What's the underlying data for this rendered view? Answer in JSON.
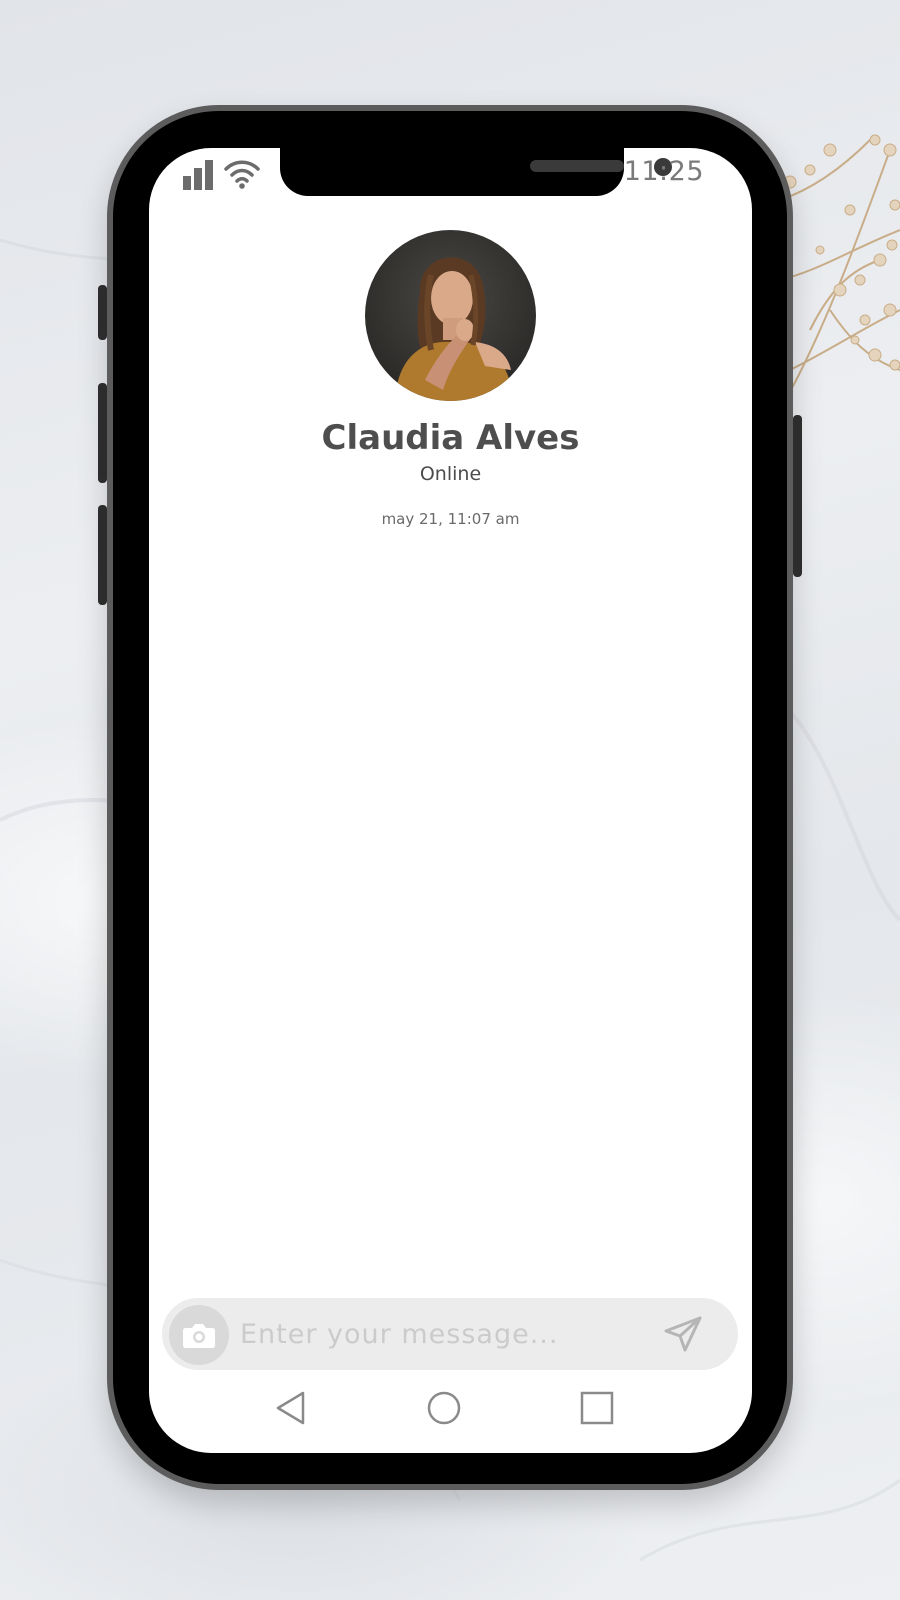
{
  "status_bar": {
    "time": "11:25",
    "signal_icon": "signal-bars-icon",
    "wifi_icon": "wifi-icon"
  },
  "contact": {
    "name": "Claudia Alves",
    "status": "Online",
    "avatar_icon": "avatar-photo"
  },
  "conversation": {
    "timestamp": "may 21, 11:07 am"
  },
  "composer": {
    "placeholder": "Enter your message...",
    "camera_icon": "camera-icon",
    "send_icon": "send-icon"
  },
  "nav_bar": {
    "back_icon": "triangle-back-icon",
    "home_icon": "circle-home-icon",
    "recents_icon": "square-recents-icon"
  },
  "colors": {
    "name_text": "#4e4e4e",
    "composer_bg": "#ececec",
    "icon_gray": "#bdbdbd"
  }
}
